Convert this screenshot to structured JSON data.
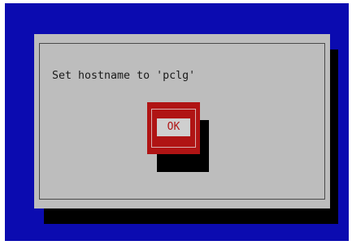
{
  "dialog": {
    "message": "Set hostname to 'pclg'",
    "ok_label": "OK"
  },
  "colors": {
    "screen_background": "#0b0bb0",
    "dialog_background": "#bdbdbd",
    "shadow": "#000000",
    "button_background": "#b01414",
    "button_label_background": "#cfcfcf",
    "button_text": "#b01414"
  }
}
